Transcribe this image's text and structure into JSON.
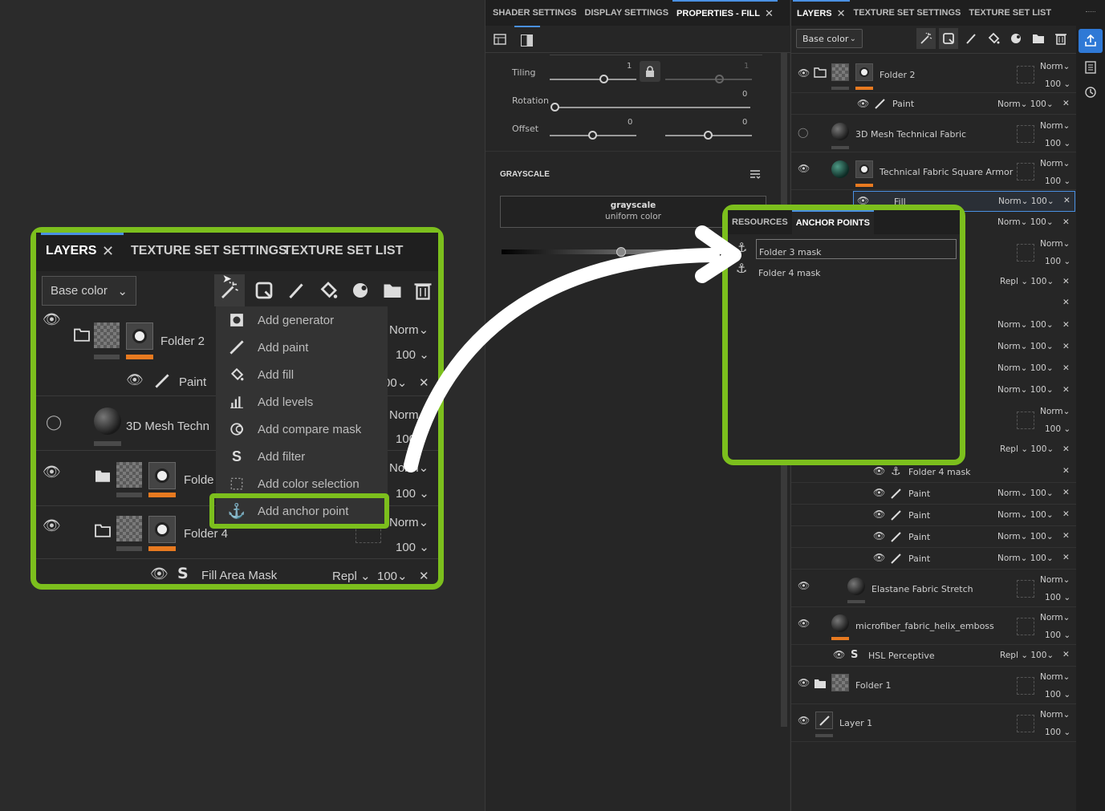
{
  "props": {
    "tabs": [
      "SHADER SETTINGS",
      "DISPLAY SETTINGS",
      "PROPERTIES - FILL"
    ],
    "tiling_label": "Tiling",
    "tiling_v1": "1",
    "tiling_v2": "1",
    "rotation_label": "Rotation",
    "rotation_v": "0",
    "offset_label": "Offset",
    "offset_v1": "0",
    "offset_v2": "0",
    "grayscale_header": "GRAYSCALE",
    "grayscale_title": "grayscale",
    "grayscale_sub": "uniform color"
  },
  "layers": {
    "tabs": [
      "LAYERS",
      "TEXTURE SET SETTINGS",
      "TEXTURE SET LIST"
    ],
    "channel": "Base color",
    "norm": "Norm",
    "repl": "Repl",
    "opacity": "100",
    "rows": {
      "folder2": "Folder 2",
      "paint": "Paint",
      "mesh3d": "3D Mesh Technical Fabric",
      "armor": "Technical Fabric Square Armor",
      "fill": "Fill",
      "folder4mask": "Folder 4 mask",
      "elastane": "Elastane Fabric Stretch",
      "microfiber": "microfiber_fabric_helix_emboss",
      "hsl": "HSL Perceptive",
      "folder1": "Folder 1",
      "layer1": "Layer 1"
    }
  },
  "anchor_panel": {
    "tabs": [
      "RESOURCES",
      "ANCHOR POINTS"
    ],
    "items": [
      "Folder 3 mask",
      "Folder 4 mask"
    ]
  },
  "zoom": {
    "tabs": [
      "LAYERS",
      "TEXTURE SET SETTINGS",
      "TEXTURE SET LIST"
    ],
    "channel": "Base color",
    "menu": [
      "Add generator",
      "Add paint",
      "Add fill",
      "Add levels",
      "Add compare mask",
      "Add filter",
      "Add color selection",
      "Add anchor point"
    ],
    "folder2": "Folder 2",
    "paint": "Paint",
    "mesh": "3D Mesh Techn",
    "folde": "Folde",
    "folder4": "Folder 4",
    "fillmask": "Fill Area Mask",
    "norm": "Norm",
    "repl": "Repl",
    "opacity": "100",
    "opacity_cut": "00",
    "opacity_cut2": "100"
  },
  "colors": {
    "accent": "#7cbf1d",
    "select": "#4a90e2",
    "orange": "#e87a20"
  }
}
